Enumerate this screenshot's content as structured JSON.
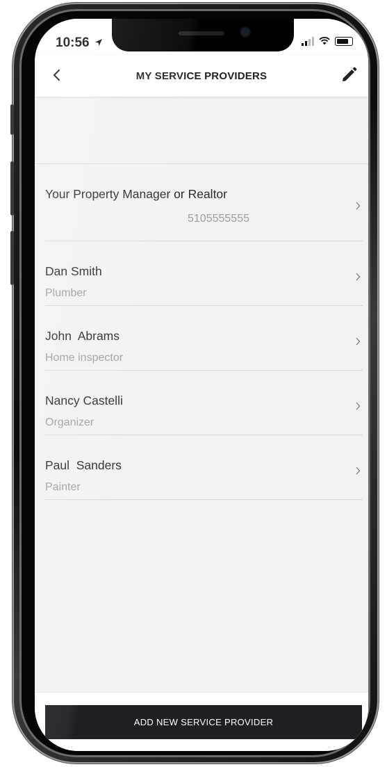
{
  "status_bar": {
    "time": "10:56",
    "location_icon": "location-arrow-icon",
    "signal_icon": "cellular-signal-icon",
    "wifi_icon": "wifi-icon",
    "battery_icon": "battery-icon"
  },
  "nav": {
    "title": "MY SERVICE PROVIDERS",
    "back_icon": "chevron-left-icon",
    "edit_icon": "pencil-icon"
  },
  "providers": [
    {
      "name": "Your Property Manager or Realtor",
      "detail": "5105555555"
    },
    {
      "name": "Dan Smith",
      "detail": "Plumber"
    },
    {
      "name": "John  Abrams",
      "detail": "Home inspector"
    },
    {
      "name": "Nancy Castelli",
      "detail": "Organizer"
    },
    {
      "name": "Paul  Sanders",
      "detail": "Painter"
    }
  ],
  "add_button": {
    "label": "ADD NEW SERVICE PROVIDER"
  },
  "colors": {
    "screen_background": "#f2f2f2",
    "button_background": "#1d1f22",
    "secondary_text": "#9e9e9e"
  }
}
